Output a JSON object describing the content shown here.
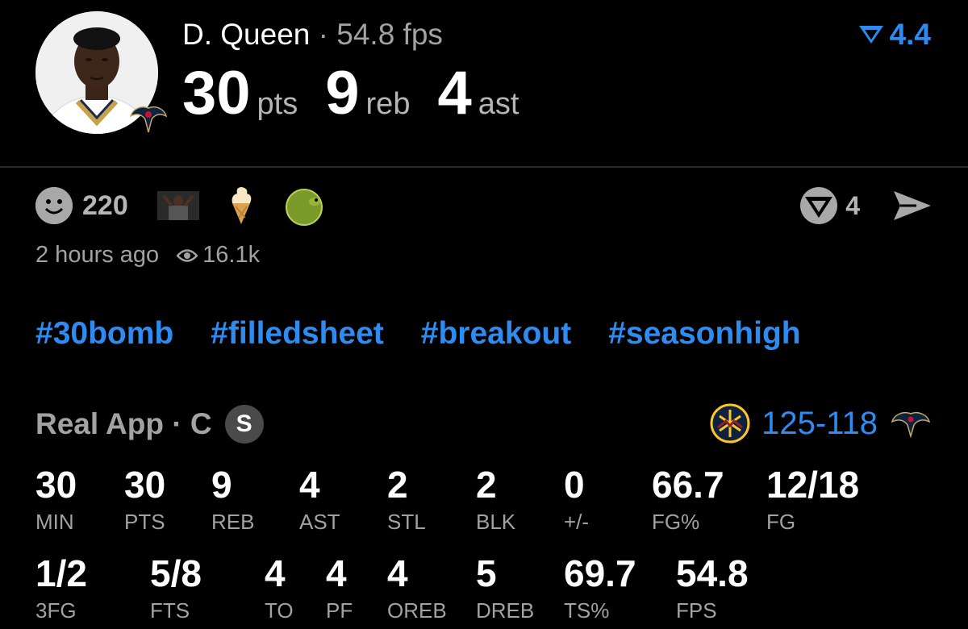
{
  "player": {
    "name": "D. Queen",
    "separator": "·",
    "fps_text": "54.8 fps",
    "pts": "30",
    "pts_unit": "pts",
    "reb": "9",
    "reb_unit": "reb",
    "ast": "4",
    "ast_unit": "ast",
    "team_logo_icon": "pelicans-logo-icon"
  },
  "rating": {
    "value": "4.4",
    "icon": "real-v-icon"
  },
  "reactions": {
    "count": "220",
    "smiley_icon": "smiley-icon",
    "emojis": [
      "player-photo-reaction",
      "soft-serve-icon",
      "bird-ball-reaction"
    ]
  },
  "share": {
    "count": "4",
    "real_icon": "real-logo-icon",
    "send_icon": "send-icon"
  },
  "meta": {
    "time_ago": "2 hours ago",
    "views": "16.1k",
    "views_icon": "eye-icon"
  },
  "hashtags": [
    "#30bomb",
    "#filledsheet",
    "#breakout",
    "#seasonhigh"
  ],
  "source": {
    "label": "Real App · C",
    "badge": "S"
  },
  "score": {
    "home": "125",
    "dash": "-",
    "away": "118",
    "home_logo": "nuggets-logo-icon",
    "away_logo": "pelicans-logo-icon"
  },
  "stats_row1": [
    {
      "value": "30",
      "label": "MIN"
    },
    {
      "value": "30",
      "label": "PTS"
    },
    {
      "value": "9",
      "label": "REB"
    },
    {
      "value": "4",
      "label": "AST"
    },
    {
      "value": "2",
      "label": "STL"
    },
    {
      "value": "2",
      "label": "BLK"
    },
    {
      "value": "0",
      "label": "+/-"
    },
    {
      "value": "66.7",
      "label": "FG%"
    },
    {
      "value": "12/18",
      "label": "FG"
    }
  ],
  "stats_row2": [
    {
      "value": "1/2",
      "label": "3FG"
    },
    {
      "value": "5/8",
      "label": "FTS"
    },
    {
      "value": "4",
      "label": "TO"
    },
    {
      "value": "4",
      "label": "PF"
    },
    {
      "value": "4",
      "label": "OREB"
    },
    {
      "value": "5",
      "label": "DREB"
    },
    {
      "value": "69.7",
      "label": "TS%"
    },
    {
      "value": "54.8",
      "label": "FPS"
    }
  ],
  "colors": {
    "accent": "#2e8bef",
    "muted": "#a2a2a2",
    "background": "#000000"
  }
}
